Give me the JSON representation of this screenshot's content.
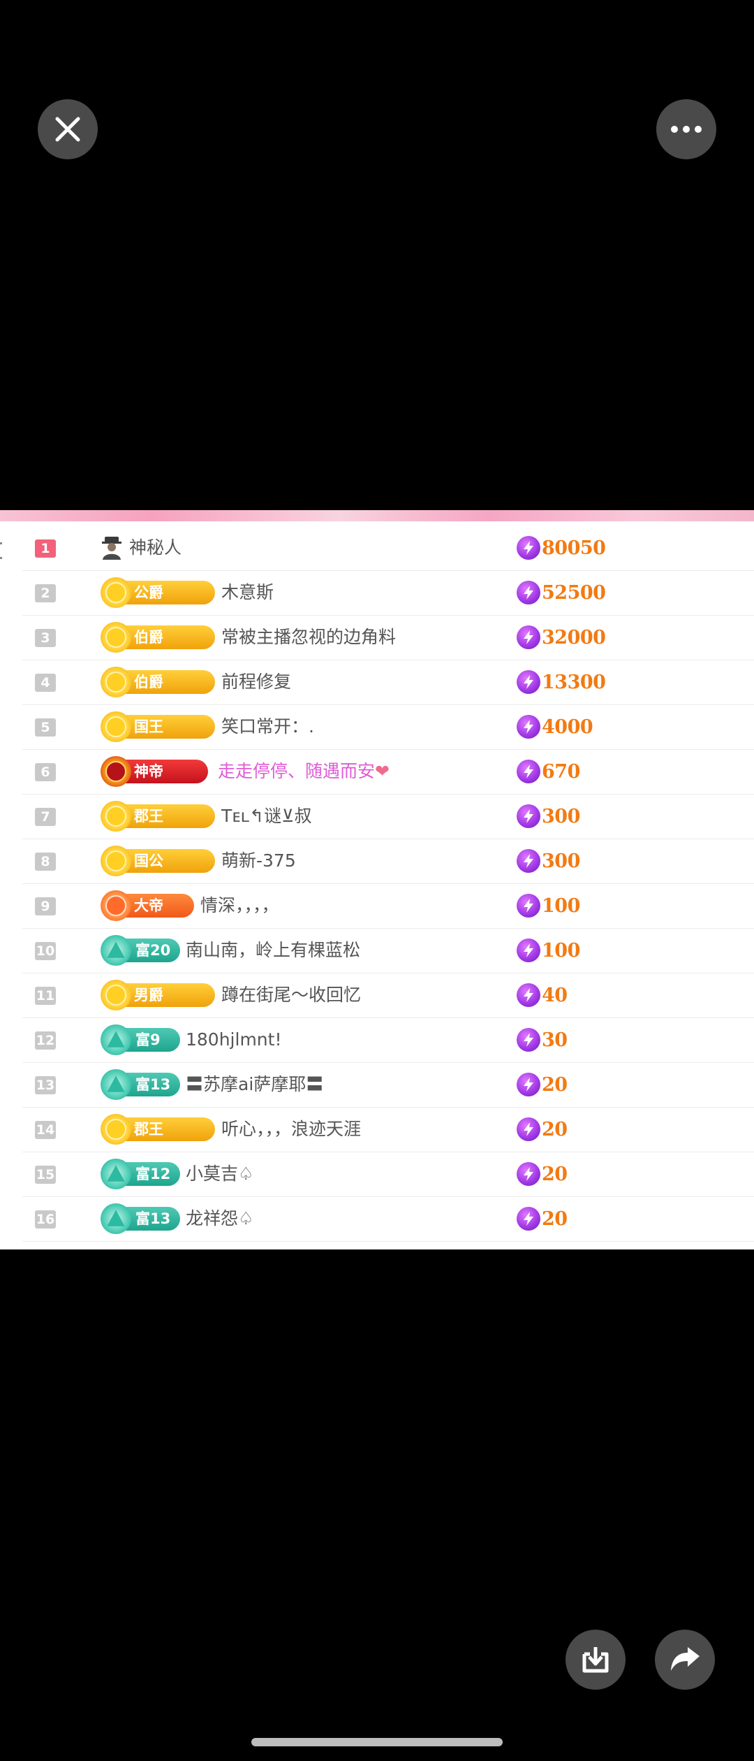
{
  "viewer": {
    "close_icon": "close-icon",
    "more_icon": "more-icon",
    "download_icon": "download-icon",
    "share_icon": "share-icon"
  },
  "ranking": [
    {
      "rank": "1",
      "badge": null,
      "mystery": true,
      "name": "神秘人",
      "value": "80050"
    },
    {
      "rank": "2",
      "badge": {
        "text": "公爵",
        "style": "gold"
      },
      "name": "木意斯",
      "value": "52500"
    },
    {
      "rank": "3",
      "badge": {
        "text": "伯爵",
        "style": "gold"
      },
      "name": "常被主播忽视的边角料",
      "value": "32000"
    },
    {
      "rank": "4",
      "badge": {
        "text": "伯爵",
        "style": "gold"
      },
      "name": "前程修复",
      "value": "13300"
    },
    {
      "rank": "5",
      "badge": {
        "text": "国王",
        "style": "gold"
      },
      "name": "笑口常开：.",
      "value": "4000"
    },
    {
      "rank": "6",
      "badge": {
        "text": "神帝",
        "style": "red"
      },
      "name": "走走停停、随遇而安",
      "name_style": "pink",
      "heart": true,
      "value": "670"
    },
    {
      "rank": "7",
      "badge": {
        "text": "郡王",
        "style": "gold"
      },
      "name": "Tᴇʟ↰谜⊻叔",
      "value": "300"
    },
    {
      "rank": "8",
      "badge": {
        "text": "国公",
        "style": "gold"
      },
      "name": "萌新-375",
      "value": "300"
    },
    {
      "rank": "9",
      "badge": {
        "text": "大帝",
        "style": "orange"
      },
      "name": "情深，，，，",
      "value": "100"
    },
    {
      "rank": "10",
      "badge": {
        "text": "富20",
        "style": "teal"
      },
      "name": "南山南，岭上有棵蓝松",
      "value": "100"
    },
    {
      "rank": "11",
      "badge": {
        "text": "男爵",
        "style": "gold"
      },
      "name": "蹲在街尾～收回忆",
      "value": "40"
    },
    {
      "rank": "12",
      "badge": {
        "text": "富9",
        "style": "teal"
      },
      "name": "180hjlmnt!",
      "value": "30"
    },
    {
      "rank": "13",
      "badge": {
        "text": "富13",
        "style": "teal"
      },
      "name": "〓苏摩ai萨摩耶〓",
      "value": "20"
    },
    {
      "rank": "14",
      "badge": {
        "text": "郡王",
        "style": "gold"
      },
      "name": "听心，，，浪迹天涯",
      "value": "20"
    },
    {
      "rank": "15",
      "badge": {
        "text": "富12",
        "style": "teal"
      },
      "name": "小莫吉♤",
      "value": "20"
    },
    {
      "rank": "16",
      "badge": {
        "text": "富13",
        "style": "teal"
      },
      "name": "龙祥怨♤",
      "value": "20"
    }
  ],
  "colors": {
    "background": "#000000",
    "value_text": "#f27a12",
    "top_rank": "#f2607a",
    "pink_name": "#e05bd6"
  }
}
